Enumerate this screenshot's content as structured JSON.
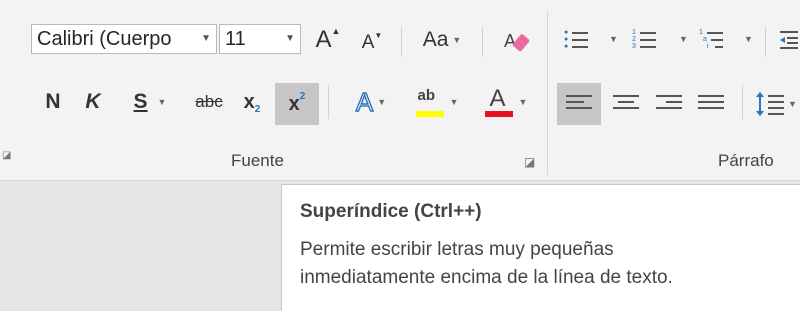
{
  "font": {
    "name_value": "Calibri (Cuerpo",
    "size_value": "11",
    "grow_label": "A",
    "shrink_label": "A",
    "case_label": "Aa",
    "bold_label": "N",
    "italic_label": "K",
    "underline_label": "S",
    "strike_label": "abc",
    "subscript_label": "x",
    "subscript_mark": "2",
    "superscript_label": "x",
    "superscript_mark": "2",
    "effects_label": "A",
    "highlight_label": "ab",
    "fontcolor_label": "A",
    "group_label": "Fuente"
  },
  "paragraph": {
    "group_label": "Párrafo"
  },
  "tooltip": {
    "title": "Superíndice (Ctrl++)",
    "line1": "Permite escribir letras muy pequeñas",
    "line2": "inmediatamente encima de la línea de texto."
  },
  "colors": {
    "highlight": "#ffff00",
    "font_color": "#e81123",
    "accent_blue": "#2a72b8"
  },
  "icons": [
    "grow-font-icon",
    "shrink-font-icon",
    "clear-formatting-icon",
    "bullets-icon",
    "numbering-icon",
    "multilevel-list-icon",
    "align-left-icon",
    "center-icon",
    "align-right-icon",
    "justify-icon",
    "line-spacing-icon",
    "dialog-launcher-icon"
  ]
}
